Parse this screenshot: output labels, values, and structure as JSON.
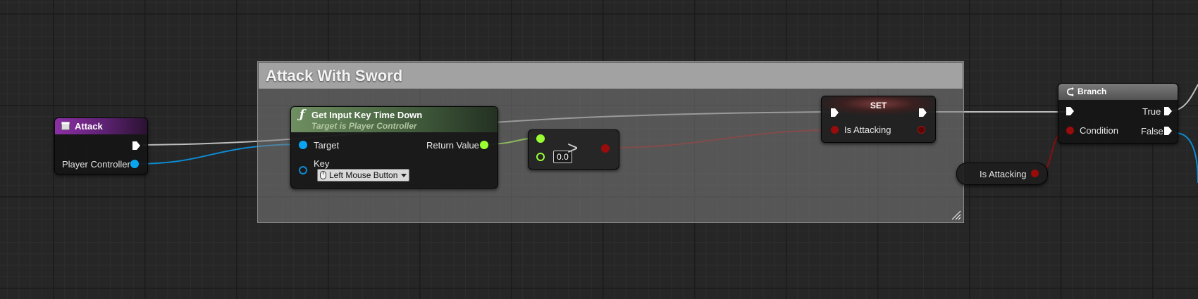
{
  "colors": {
    "exec": "#ffffff",
    "object_pin": "#0aa5f2",
    "float_pin": "#99ff33",
    "bool_pin": "#9a0b0b",
    "event_header": "#7a2b8f",
    "function_header": "#55704a",
    "comment_bg": "#808080"
  },
  "comment": {
    "title": "Attack With Sword"
  },
  "attack_node": {
    "title": "Attack",
    "icon": "event-icon",
    "output_label": "Player Controller"
  },
  "input_key_node": {
    "title": "Get Input Key Time Down",
    "subtitle": "Target is Player Controller",
    "icon": "function-icon",
    "target_label": "Target",
    "key_label": "Key",
    "key_value": "Left Mouse Button",
    "key_icon": "mouse-icon",
    "return_label": "Return Value"
  },
  "compare_node": {
    "operator": ">",
    "value": "0.0"
  },
  "set_node": {
    "title": "SET",
    "var_label": "Is Attacking"
  },
  "getter_node": {
    "label": "Is Attacking"
  },
  "branch_node": {
    "title": "Branch",
    "icon": "branch-icon",
    "condition_label": "Condition",
    "true_label": "True",
    "false_label": "False"
  }
}
